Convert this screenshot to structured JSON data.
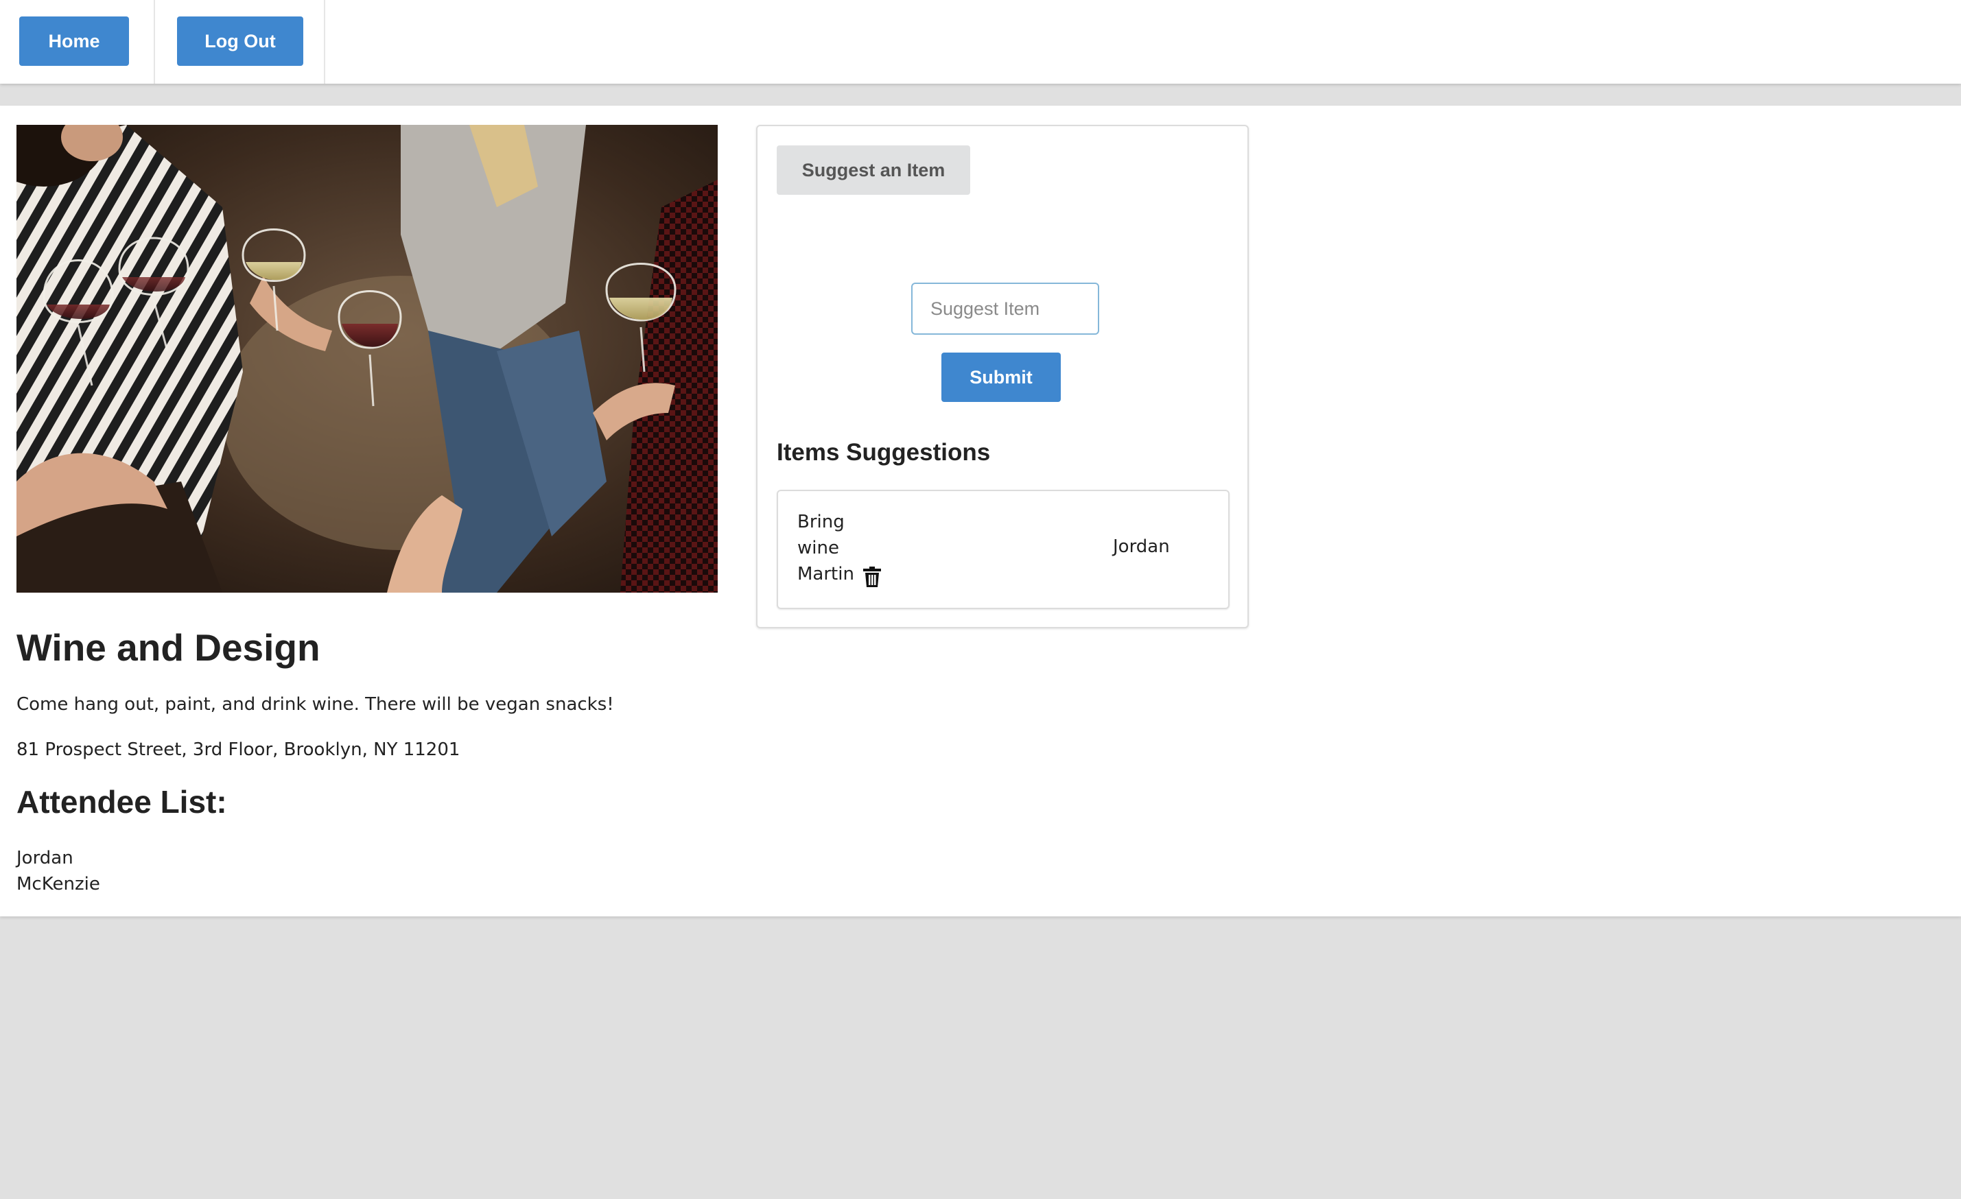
{
  "nav": {
    "home_label": "Home",
    "logout_label": "Log Out"
  },
  "event": {
    "hero_image": "people-toasting-wine-glasses-photo",
    "title": "Wine and Design",
    "description": "Come hang out, paint, and drink wine. There will be vegan snacks!",
    "address": "81 Prospect Street, 3rd Floor, Brooklyn, NY 11201"
  },
  "attendees": {
    "heading": "Attendee List:",
    "names": [
      "Jordan",
      "McKenzie"
    ]
  },
  "suggestions": {
    "toggle_label": "Suggest an Item",
    "input_placeholder": "Suggest Item",
    "input_value": "",
    "submit_label": "Submit",
    "heading": "Items Suggestions",
    "items": [
      {
        "text_lines": [
          "Bring",
          "wine",
          "Martin"
        ],
        "delete_icon": "trash-icon",
        "user": "Jordan"
      }
    ]
  },
  "colors": {
    "primary": "#3f87cf",
    "secondary": "#e0e1e2",
    "page_bg": "#e0e0e0"
  }
}
